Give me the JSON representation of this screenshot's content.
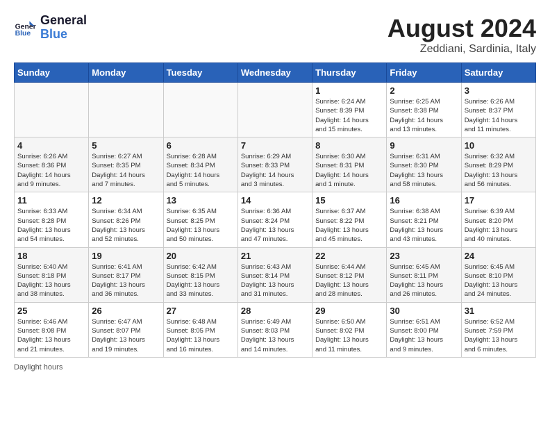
{
  "header": {
    "logo_line1": "General",
    "logo_line2": "Blue",
    "title": "August 2024",
    "subtitle": "Zeddiani, Sardinia, Italy"
  },
  "footer": {
    "daylight_label": "Daylight hours"
  },
  "weekdays": [
    "Sunday",
    "Monday",
    "Tuesday",
    "Wednesday",
    "Thursday",
    "Friday",
    "Saturday"
  ],
  "weeks": [
    [
      {
        "num": "",
        "info": ""
      },
      {
        "num": "",
        "info": ""
      },
      {
        "num": "",
        "info": ""
      },
      {
        "num": "",
        "info": ""
      },
      {
        "num": "1",
        "info": "Sunrise: 6:24 AM\nSunset: 8:39 PM\nDaylight: 14 hours\nand 15 minutes."
      },
      {
        "num": "2",
        "info": "Sunrise: 6:25 AM\nSunset: 8:38 PM\nDaylight: 14 hours\nand 13 minutes."
      },
      {
        "num": "3",
        "info": "Sunrise: 6:26 AM\nSunset: 8:37 PM\nDaylight: 14 hours\nand 11 minutes."
      }
    ],
    [
      {
        "num": "4",
        "info": "Sunrise: 6:26 AM\nSunset: 8:36 PM\nDaylight: 14 hours\nand 9 minutes."
      },
      {
        "num": "5",
        "info": "Sunrise: 6:27 AM\nSunset: 8:35 PM\nDaylight: 14 hours\nand 7 minutes."
      },
      {
        "num": "6",
        "info": "Sunrise: 6:28 AM\nSunset: 8:34 PM\nDaylight: 14 hours\nand 5 minutes."
      },
      {
        "num": "7",
        "info": "Sunrise: 6:29 AM\nSunset: 8:33 PM\nDaylight: 14 hours\nand 3 minutes."
      },
      {
        "num": "8",
        "info": "Sunrise: 6:30 AM\nSunset: 8:31 PM\nDaylight: 14 hours\nand 1 minute."
      },
      {
        "num": "9",
        "info": "Sunrise: 6:31 AM\nSunset: 8:30 PM\nDaylight: 13 hours\nand 58 minutes."
      },
      {
        "num": "10",
        "info": "Sunrise: 6:32 AM\nSunset: 8:29 PM\nDaylight: 13 hours\nand 56 minutes."
      }
    ],
    [
      {
        "num": "11",
        "info": "Sunrise: 6:33 AM\nSunset: 8:28 PM\nDaylight: 13 hours\nand 54 minutes."
      },
      {
        "num": "12",
        "info": "Sunrise: 6:34 AM\nSunset: 8:26 PM\nDaylight: 13 hours\nand 52 minutes."
      },
      {
        "num": "13",
        "info": "Sunrise: 6:35 AM\nSunset: 8:25 PM\nDaylight: 13 hours\nand 50 minutes."
      },
      {
        "num": "14",
        "info": "Sunrise: 6:36 AM\nSunset: 8:24 PM\nDaylight: 13 hours\nand 47 minutes."
      },
      {
        "num": "15",
        "info": "Sunrise: 6:37 AM\nSunset: 8:22 PM\nDaylight: 13 hours\nand 45 minutes."
      },
      {
        "num": "16",
        "info": "Sunrise: 6:38 AM\nSunset: 8:21 PM\nDaylight: 13 hours\nand 43 minutes."
      },
      {
        "num": "17",
        "info": "Sunrise: 6:39 AM\nSunset: 8:20 PM\nDaylight: 13 hours\nand 40 minutes."
      }
    ],
    [
      {
        "num": "18",
        "info": "Sunrise: 6:40 AM\nSunset: 8:18 PM\nDaylight: 13 hours\nand 38 minutes."
      },
      {
        "num": "19",
        "info": "Sunrise: 6:41 AM\nSunset: 8:17 PM\nDaylight: 13 hours\nand 36 minutes."
      },
      {
        "num": "20",
        "info": "Sunrise: 6:42 AM\nSunset: 8:15 PM\nDaylight: 13 hours\nand 33 minutes."
      },
      {
        "num": "21",
        "info": "Sunrise: 6:43 AM\nSunset: 8:14 PM\nDaylight: 13 hours\nand 31 minutes."
      },
      {
        "num": "22",
        "info": "Sunrise: 6:44 AM\nSunset: 8:12 PM\nDaylight: 13 hours\nand 28 minutes."
      },
      {
        "num": "23",
        "info": "Sunrise: 6:45 AM\nSunset: 8:11 PM\nDaylight: 13 hours\nand 26 minutes."
      },
      {
        "num": "24",
        "info": "Sunrise: 6:45 AM\nSunset: 8:10 PM\nDaylight: 13 hours\nand 24 minutes."
      }
    ],
    [
      {
        "num": "25",
        "info": "Sunrise: 6:46 AM\nSunset: 8:08 PM\nDaylight: 13 hours\nand 21 minutes."
      },
      {
        "num": "26",
        "info": "Sunrise: 6:47 AM\nSunset: 8:07 PM\nDaylight: 13 hours\nand 19 minutes."
      },
      {
        "num": "27",
        "info": "Sunrise: 6:48 AM\nSunset: 8:05 PM\nDaylight: 13 hours\nand 16 minutes."
      },
      {
        "num": "28",
        "info": "Sunrise: 6:49 AM\nSunset: 8:03 PM\nDaylight: 13 hours\nand 14 minutes."
      },
      {
        "num": "29",
        "info": "Sunrise: 6:50 AM\nSunset: 8:02 PM\nDaylight: 13 hours\nand 11 minutes."
      },
      {
        "num": "30",
        "info": "Sunrise: 6:51 AM\nSunset: 8:00 PM\nDaylight: 13 hours\nand 9 minutes."
      },
      {
        "num": "31",
        "info": "Sunrise: 6:52 AM\nSunset: 7:59 PM\nDaylight: 13 hours\nand 6 minutes."
      }
    ]
  ]
}
